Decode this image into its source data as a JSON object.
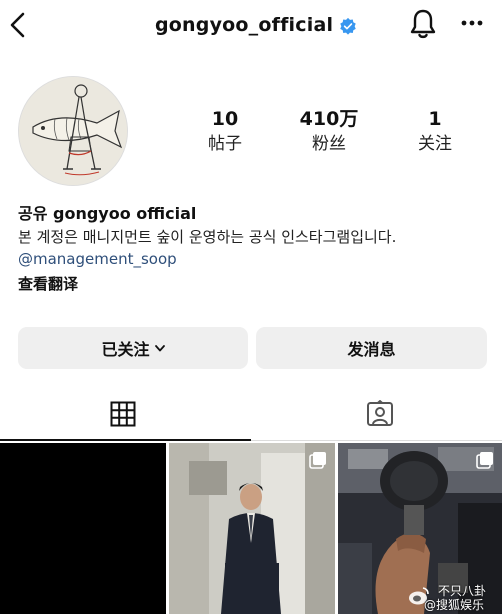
{
  "header": {
    "username": "gongyoo_official",
    "icons": {
      "back": "back-arrow-icon",
      "verified": "verified-badge-icon",
      "bell": "bell-icon",
      "more": "more-icon"
    },
    "accent_color": "#3897f0"
  },
  "profile": {
    "stats": [
      {
        "value": "10",
        "label": "帖子"
      },
      {
        "value": "410万",
        "label": "粉丝"
      },
      {
        "value": "1",
        "label": "关注"
      }
    ],
    "bio_name": "공유 gongyoo official",
    "bio_text": "본 계정은 매니지먼트 숲이 운영하는 공식 인스타그램입니다.",
    "link": "@management_soop",
    "translate_label": "查看翻译"
  },
  "actions": {
    "follow_label": "已关注",
    "message_label": "发消息"
  },
  "tabs": [
    {
      "icon": "grid-icon",
      "active": true
    },
    {
      "icon": "tagged-icon",
      "active": false
    }
  ],
  "posts": [
    {
      "kind": "black"
    },
    {
      "kind": "photo-suit",
      "multi": true
    },
    {
      "kind": "photo-gym",
      "multi": true
    }
  ],
  "watermark": {
    "line1": "不只八卦",
    "line2": "@搜狐娱乐"
  }
}
